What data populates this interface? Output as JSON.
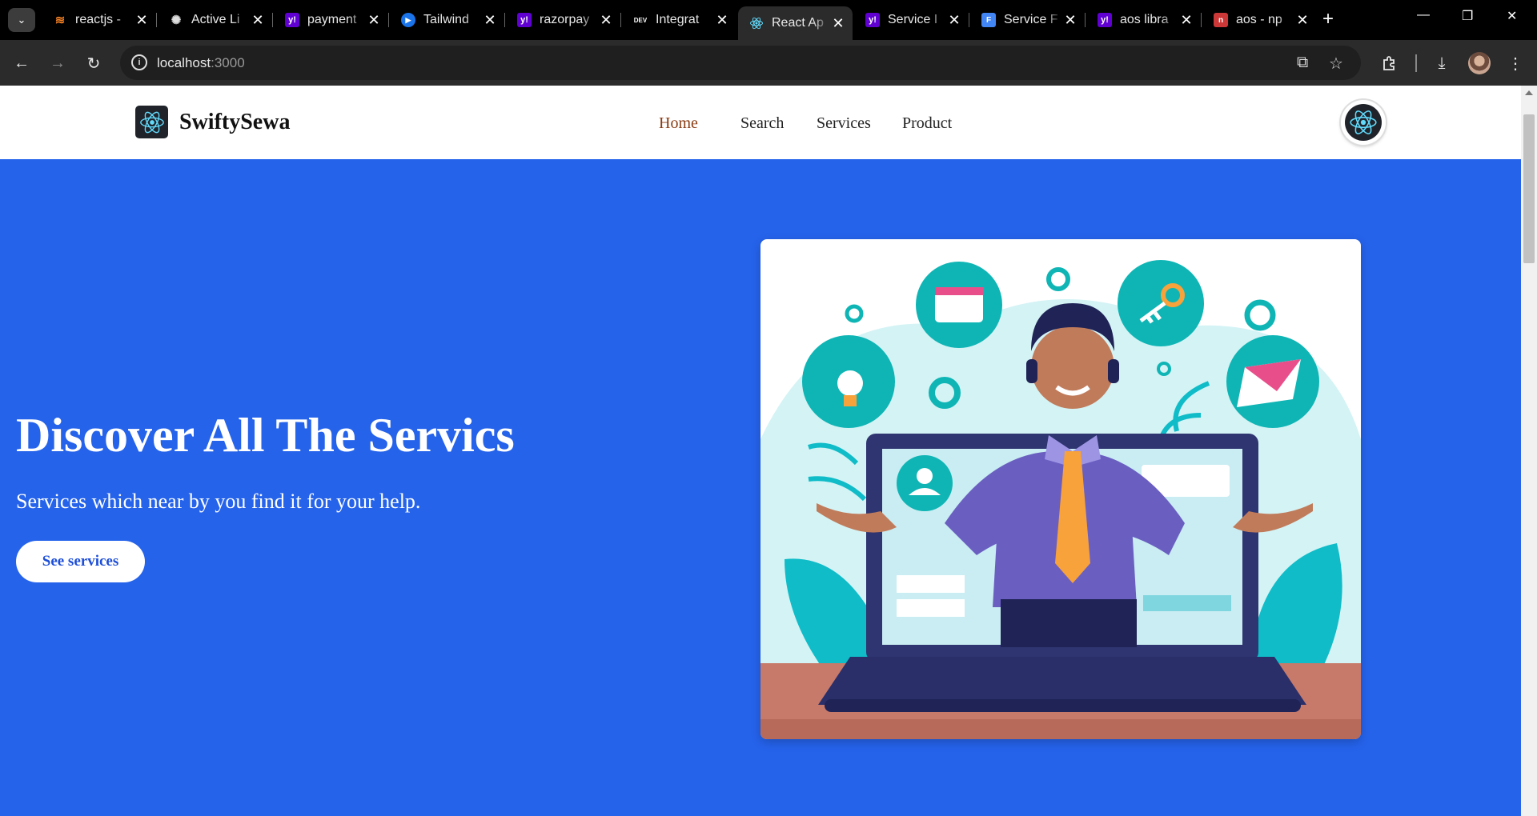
{
  "browser": {
    "tabs": [
      {
        "title": "reactjs -",
        "favicon": "stackoverflow-icon",
        "color": "#f48024"
      },
      {
        "title": "Active Li",
        "favicon": "openai-icon",
        "color": "#000000"
      },
      {
        "title": "payment",
        "favicon": "yahoo-icon",
        "color": "#6001d2"
      },
      {
        "title": "Tailwind",
        "favicon": "play-icon",
        "color": "#1a73e8"
      },
      {
        "title": "razorpay",
        "favicon": "yahoo-icon",
        "color": "#6001d2"
      },
      {
        "title": "Integrat",
        "favicon": "dev-icon",
        "color": "#000000"
      },
      {
        "title": "React Ap",
        "favicon": "react-icon",
        "color": "#61dafb",
        "active": true
      },
      {
        "title": "Service I",
        "favicon": "yahoo-icon",
        "color": "#6001d2"
      },
      {
        "title": "Service F",
        "favicon": "forms-icon",
        "color": "#4285f4"
      },
      {
        "title": "aos libra",
        "favicon": "yahoo-icon",
        "color": "#6001d2"
      },
      {
        "title": "aos - np",
        "favicon": "npm-icon",
        "color": "#cb3837"
      }
    ],
    "url_host": "localhost",
    "url_port": ":3000"
  },
  "site": {
    "brand": "SwiftySewa",
    "nav": [
      {
        "label": "Home",
        "active": true
      },
      {
        "label": "Search"
      },
      {
        "label": "Services"
      },
      {
        "label": "Product"
      }
    ]
  },
  "hero": {
    "title": "Discover All The Servics",
    "subtitle": "Services which near by you find it for your help.",
    "button": "See services",
    "background": "#2563eb",
    "image": "customer-service-illustration"
  }
}
